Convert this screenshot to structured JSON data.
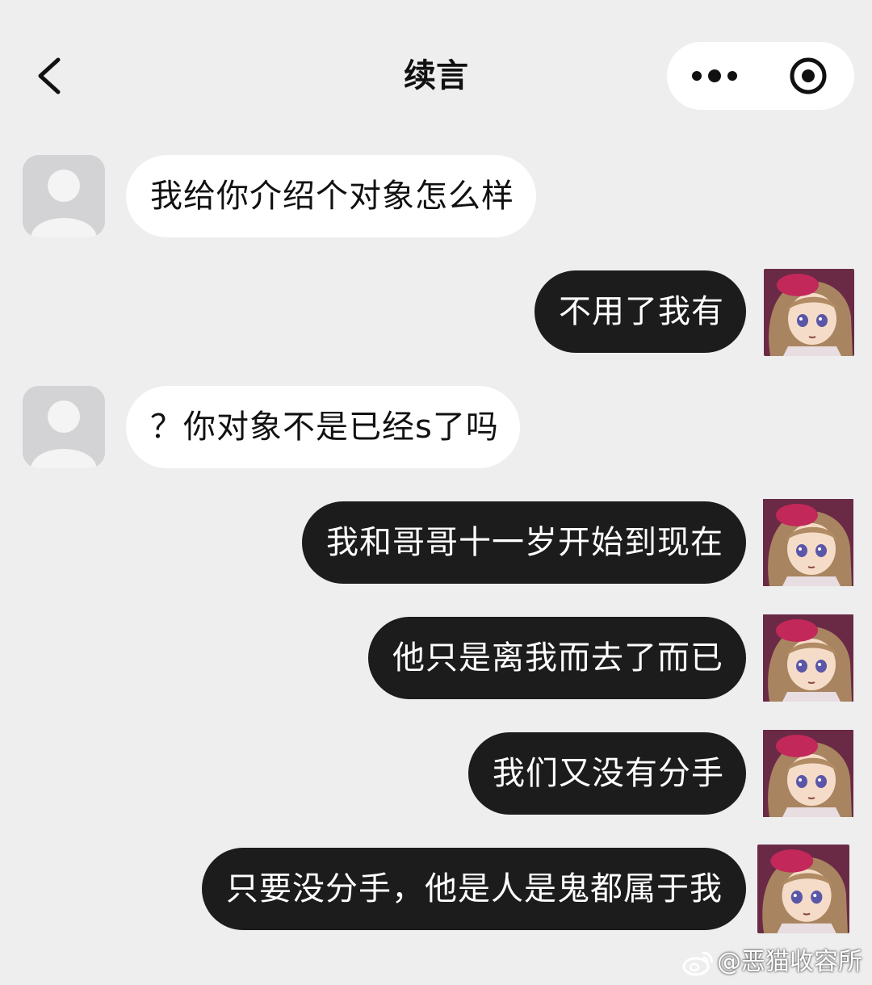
{
  "header": {
    "title": "续言",
    "back_icon": "chevron-left-icon",
    "more_icon": "more-dots-icon",
    "close_icon": "target-circle-icon"
  },
  "messages": [
    {
      "side": "left",
      "text": "我给你介绍个对象怎么样",
      "avatar": "default-avatar"
    },
    {
      "side": "right",
      "text": "不用了我有",
      "avatar": "anime-avatar"
    },
    {
      "side": "left",
      "text": "？你对象不是已经s了吗",
      "avatar": "default-avatar"
    },
    {
      "side": "right",
      "text": "我和哥哥十一岁开始到现在",
      "avatar": "anime-avatar"
    },
    {
      "side": "right",
      "text": "他只是离我而去了而已",
      "avatar": "anime-avatar"
    },
    {
      "side": "right",
      "text": "我们又没有分手",
      "avatar": "anime-avatar"
    },
    {
      "side": "right",
      "text": "只要没分手，他是人是鬼都属于我",
      "avatar": "anime-avatar"
    }
  ],
  "watermark": {
    "text": "@恶猫收容所",
    "icon": "weibo-icon"
  },
  "colors": {
    "background": "#eeeeef",
    "left_bubble": "#ffffff",
    "right_bubble": "#1c1c1c"
  }
}
